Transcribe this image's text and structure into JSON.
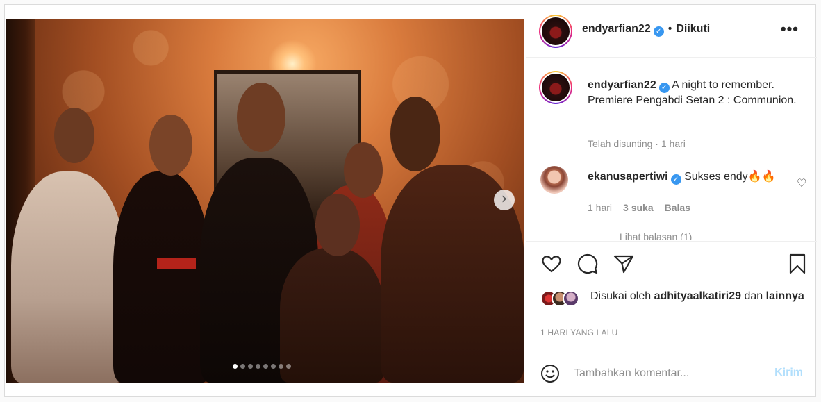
{
  "post": {
    "username": "endyarfian22",
    "follow_separator": "•",
    "follow_status": "Diikuti",
    "more_label": "•••",
    "caption": "A night to remember. Premiere Pengabdi Setan 2 : Communion.",
    "edited_label": "Telah disunting",
    "caption_time": "1 hari",
    "carousel": {
      "next_label": "›",
      "total_slides": 8,
      "active_index": 0
    }
  },
  "comment": {
    "username": "ekanusapertiwi",
    "text": "Sukses endy",
    "emoji": "🔥🔥",
    "time": "1 hari",
    "likes": "3 suka",
    "reply_label": "Balas",
    "view_replies": "Lihat balasan (1)"
  },
  "likes": {
    "prefix": "Disukai oleh",
    "user": "adhityaalkatiri29",
    "connector": "dan",
    "others": "lainnya"
  },
  "time_ago": "1 HARI YANG LALU",
  "composer": {
    "placeholder": "Tambahkan komentar...",
    "post_label": "Kirim"
  },
  "icons": {
    "like": "heart-icon",
    "comment": "comment-icon",
    "share": "paper-plane-icon",
    "save": "bookmark-icon",
    "emoji": "smiley-icon"
  }
}
